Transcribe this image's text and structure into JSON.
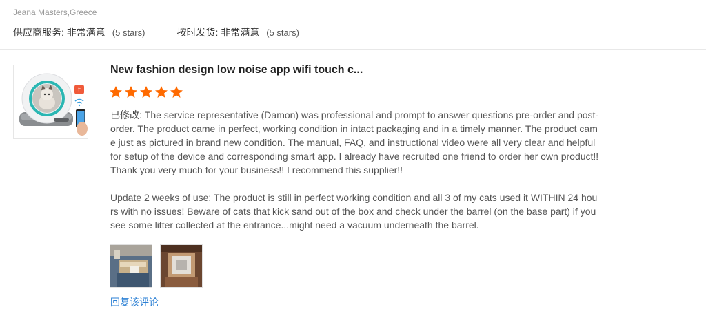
{
  "reviewer": {
    "name_country": "Jeana Masters,Greece"
  },
  "ratings": [
    {
      "label": "供应商服务: 非常满意",
      "note": "(5 stars)"
    },
    {
      "label": "按时发货: 非常满意",
      "note": "(5 stars)"
    }
  ],
  "review": {
    "product_title": "New fashion design low noise app wifi touch c...",
    "star_rating": 5,
    "star_color": "#ff6a00",
    "edited_tag": "已修改:",
    "text": " The service representative (Damon) was professional and prompt to answer questions pre-order and post-order. The product came in perfect, working condition in intact packaging and in a timely manner. The product came just as pictured in brand new condition. The manual, FAQ, and instructional video were all very clear and helpful for setup of the device and corresponding smart app. I already have recruited one friend to order her own product!! Thank you very much for your business!! I recommend this supplier!!",
    "update": "Update 2 weeks of use: The product is still in perfect working condition and all 3 of my cats used it WITHIN 24 hours with no issues! Beware of cats that kick sand out of the box and check under the barrel (on the base part) if you see some litter collected at the entrance...might need a vacuum underneath the barrel.",
    "reply_link": "回复该评论"
  },
  "colors": {
    "link": "#2a7fd4",
    "accent_teal": "#2bb7b3"
  }
}
